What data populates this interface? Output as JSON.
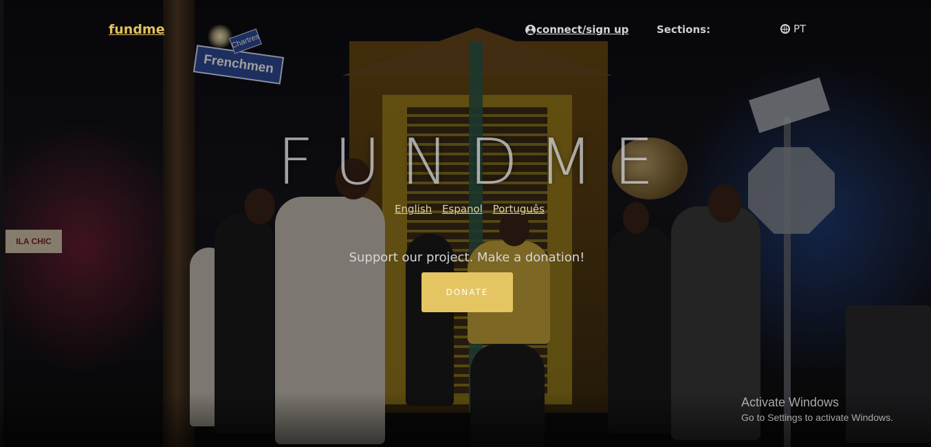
{
  "nav": {
    "logo": "fundme",
    "connect": "connect/sign up",
    "sections_label": "Sections:",
    "language_toggle": "PT"
  },
  "hero": {
    "title": "FUNDME",
    "languages": [
      "English",
      "Espanol",
      "Português"
    ],
    "tagline": "Support our project. Make a donation!",
    "donate_button": "DONATE"
  },
  "background": {
    "street_sign": "Frenchmen",
    "cross_sign": "Chartres",
    "storefront_sign": "ILA CHIC"
  },
  "watermark": {
    "title": "Activate Windows",
    "subtitle": "Go to Settings to activate Windows."
  },
  "colors": {
    "accent": "#e5c562",
    "logo": "#e3c05a"
  },
  "icons": {
    "connect": "user-circle-icon",
    "language": "globe-icon"
  }
}
